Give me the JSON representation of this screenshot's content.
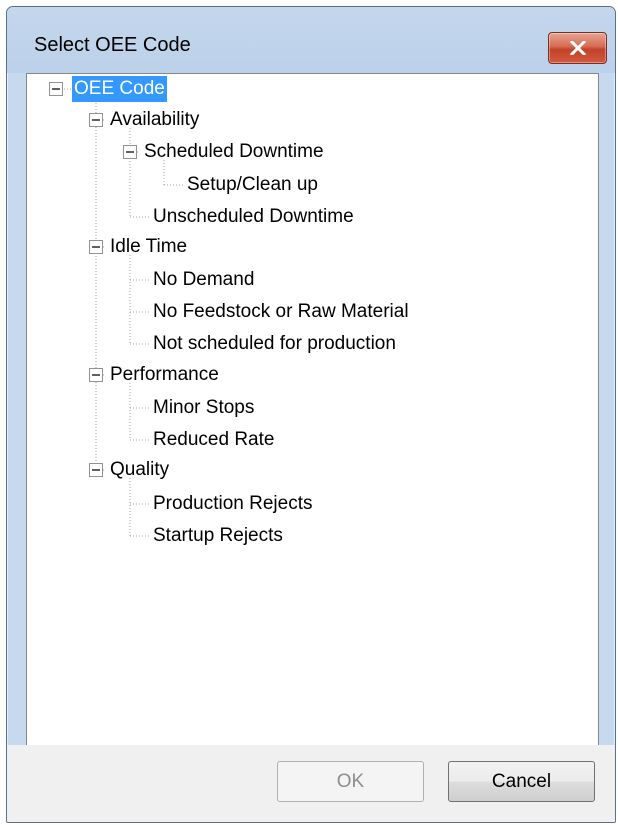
{
  "window": {
    "title": "Select OEE Code"
  },
  "tree": {
    "root": "OEE Code",
    "availability": "Availability",
    "scheduled_downtime": "Scheduled Downtime",
    "setup_clean_up": "Setup/Clean up",
    "unscheduled_downtime": "Unscheduled Downtime",
    "idle_time": "Idle Time",
    "no_demand": "No Demand",
    "no_feedstock": "No Feedstock or Raw Material",
    "not_scheduled": "Not scheduled for production",
    "performance": "Performance",
    "minor_stops": "Minor Stops",
    "reduced_rate": "Reduced Rate",
    "quality": "Quality",
    "production_rejects": "Production Rejects",
    "startup_rejects": "Startup Rejects",
    "selected": "OEE Code"
  },
  "buttons": {
    "ok": "OK",
    "cancel": "Cancel"
  },
  "icons": {
    "close": "close-icon",
    "expander": "minus-box-icon"
  },
  "colors": {
    "selection": "#3399ff",
    "close_button": "#c2422a",
    "title_bar": "#c3d6ec"
  }
}
